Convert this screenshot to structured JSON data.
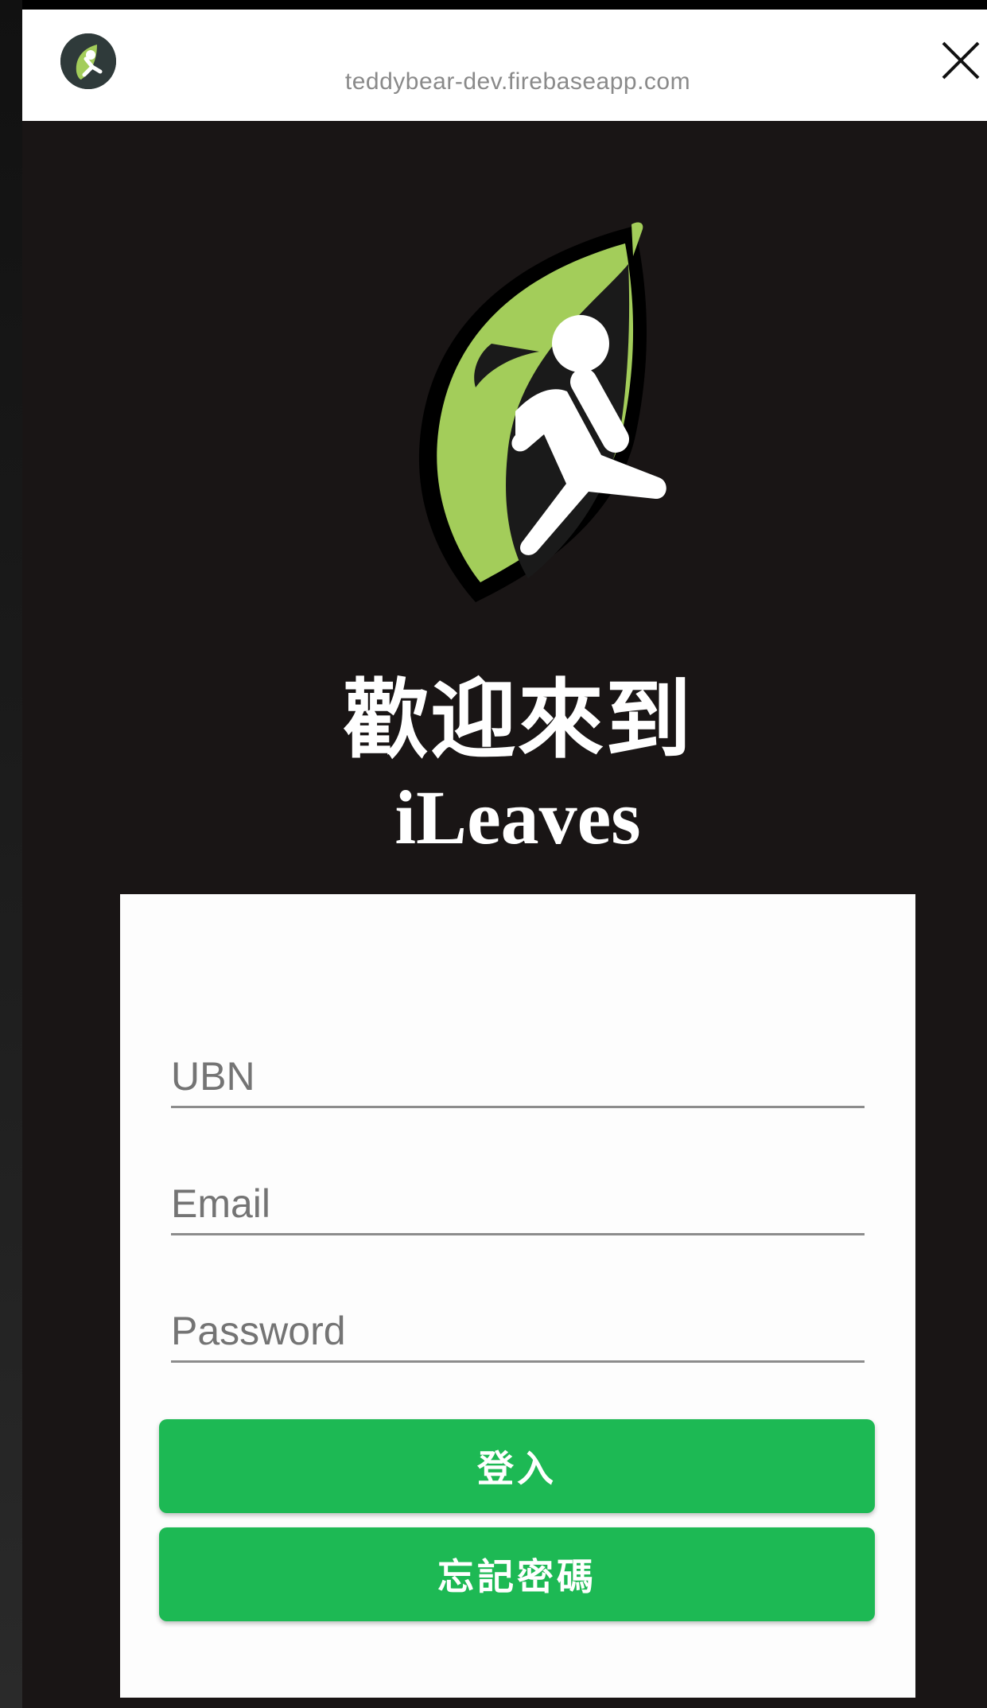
{
  "browser": {
    "url": "teddybear-dev.firebaseapp.com",
    "site_icon": "ileaves-logo-icon",
    "close_icon": "close-icon"
  },
  "hero": {
    "logo": "ileaves-leaf-logo",
    "welcome": "歡迎來到",
    "brand": "iLeaves"
  },
  "form": {
    "ubn": {
      "value": "",
      "placeholder": "UBN"
    },
    "email": {
      "value": "",
      "placeholder": "Email"
    },
    "password": {
      "value": "",
      "placeholder": "Password"
    },
    "login_label": "登入",
    "forgot_label": "忘記密碼"
  },
  "colors": {
    "accent_green": "#1db954",
    "leaf_green": "#a3cd5a",
    "background": "#191515"
  }
}
